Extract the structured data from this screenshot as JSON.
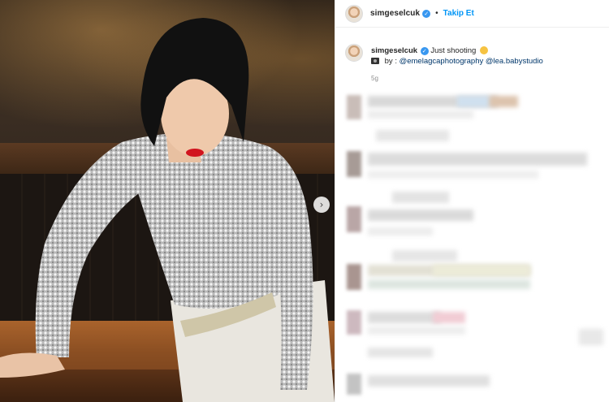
{
  "post": {
    "username": "simgeselcuk",
    "verified_icon": "verified-badge-icon",
    "separator": "•",
    "follow_label": "Takip Et",
    "caption_text": "Just shooting",
    "credits_prefix": "by : ",
    "mention_1": "@emelagcaphotography",
    "mention_2": "@lea.babystudio",
    "time_ago": "5g"
  },
  "icons": {
    "next": "chevron-right-icon",
    "camera": "camera-emoji-icon",
    "smile": "smile-emoji-icon"
  },
  "colors": {
    "link_blue": "#0095f6",
    "mention": "#00376b",
    "verified": "#3897f0"
  }
}
